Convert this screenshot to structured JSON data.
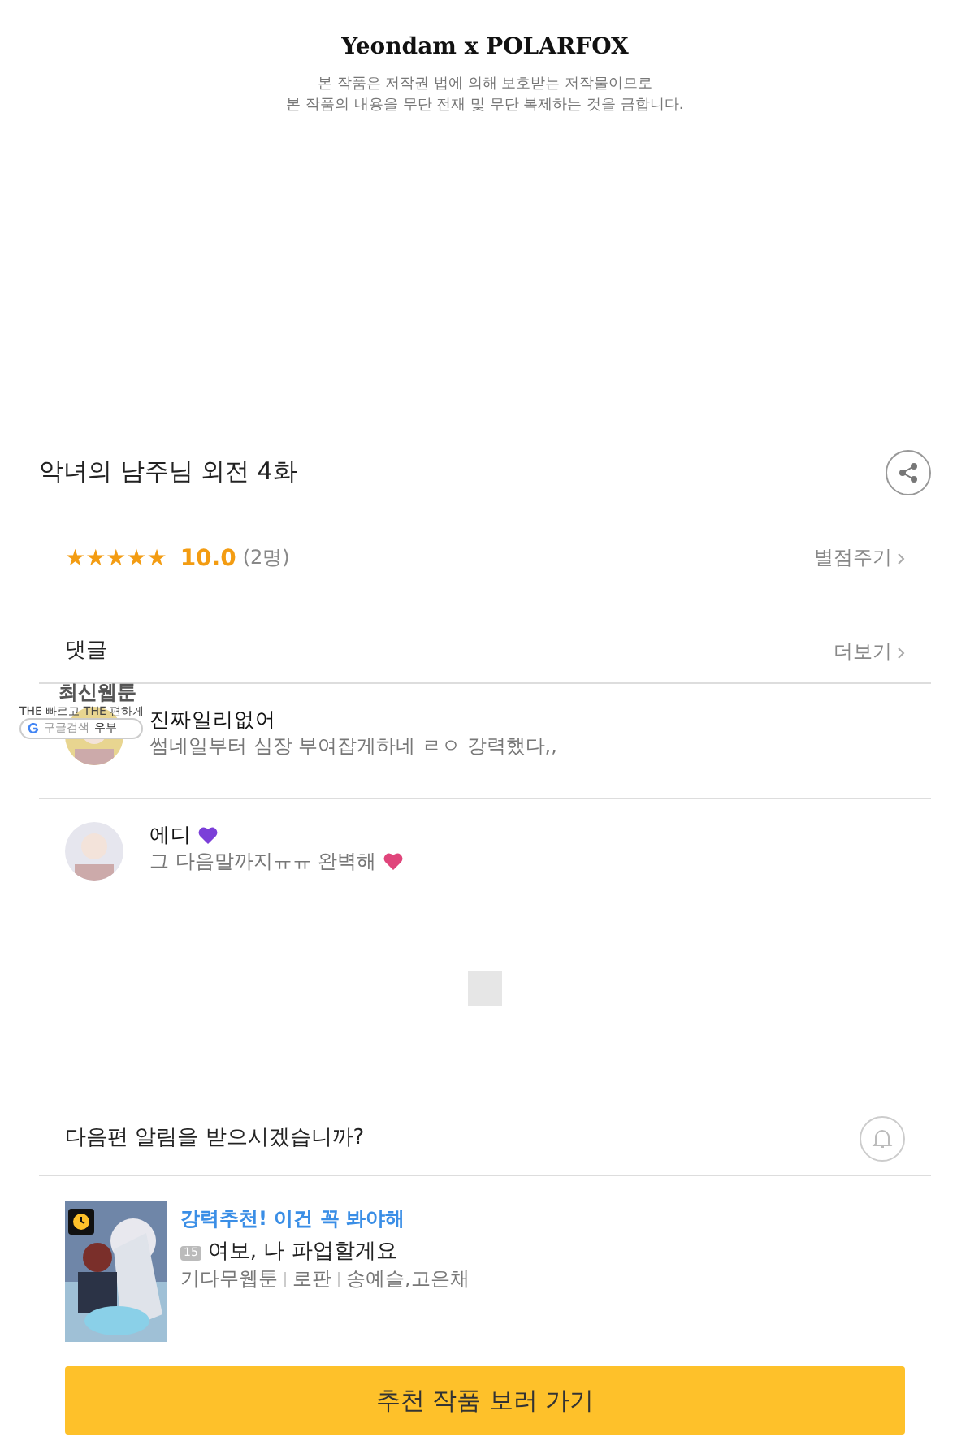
{
  "header": {
    "logo": "Yeondam x POLARFOX",
    "notice": [
      "본 작품은 저작권 법에 의해 보호받는 저작물이므로",
      "본 작품의 내용을 무단 전재 및 무단 복제하는 것을 금합니다."
    ]
  },
  "episode": {
    "title": "악녀의 남주님 외전 4화"
  },
  "rating": {
    "stars": 5,
    "score": "10.0",
    "count": "(2명)",
    "action": "별점주기"
  },
  "comments": {
    "title": "댓글",
    "more": "더보기",
    "items": [
      {
        "name": "진짜일리없어",
        "text": "썸네일부터 심장 부여잡게하네 ㄹㅇ 강력했다,,"
      },
      {
        "name": "에디",
        "text": "그 다음말까지ㅠㅠ 완벽해"
      }
    ]
  },
  "ad_overlay": {
    "title": "최신웹툰",
    "tagline": "THE 빠르고 THE 편하게",
    "search": "구글검색",
    "tab": "우부"
  },
  "notify": {
    "question": "다음편 알림을 받으시겠습니까?"
  },
  "recommend": {
    "tag": "강력추천! 이건 꼭 봐야해",
    "age": "15",
    "title": "여보, 나 파업할게요",
    "meta": [
      "기다무웹툰",
      "로판",
      "송예슬,고은채"
    ],
    "button": "추천 작품 보러 가기"
  }
}
